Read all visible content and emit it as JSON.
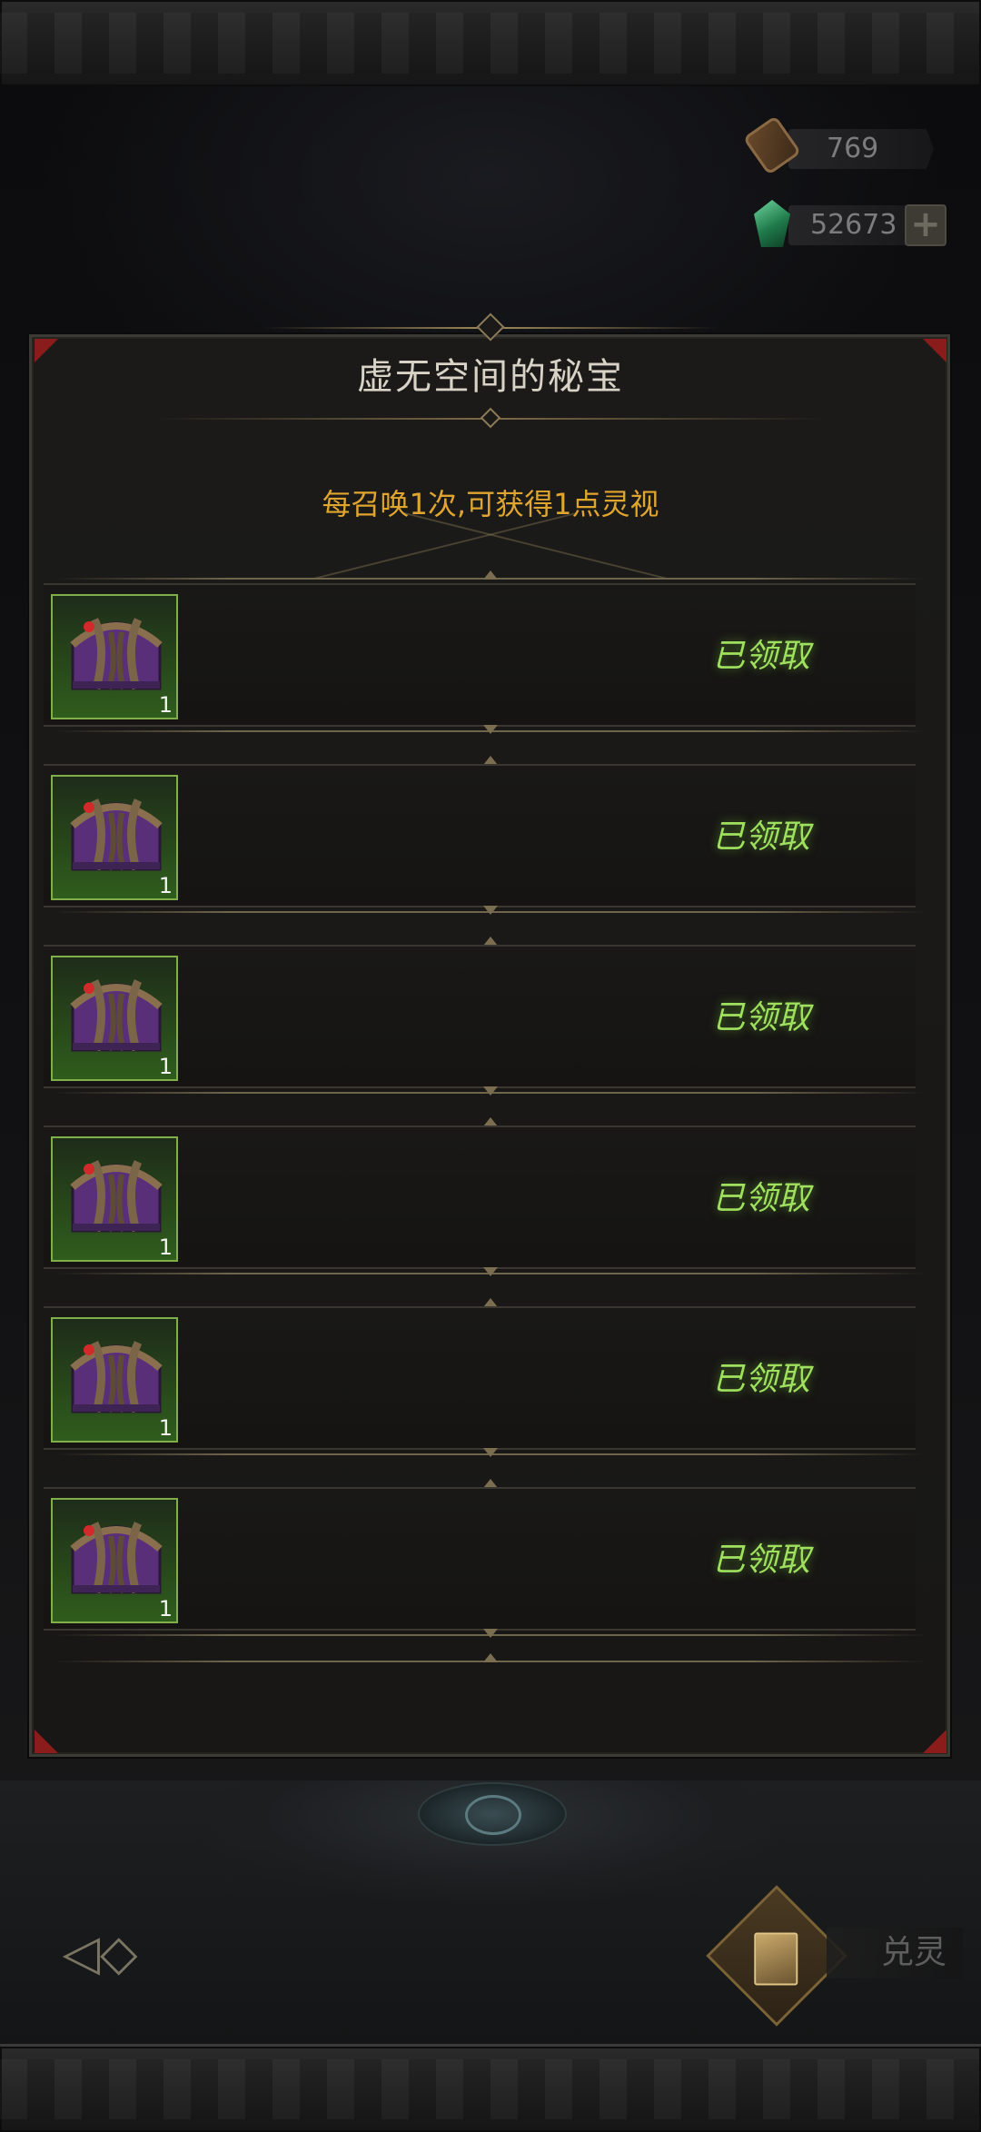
{
  "currency": {
    "scrolls": "769",
    "gems": "52673",
    "plus_label": "+"
  },
  "panel": {
    "title": "虚无空间的秘宝",
    "subtitle": "每召唤1次,可获得1点灵视"
  },
  "rewards": [
    {
      "quantity": "1",
      "status": "已领取"
    },
    {
      "quantity": "1",
      "status": "已领取"
    },
    {
      "quantity": "1",
      "status": "已领取"
    },
    {
      "quantity": "1",
      "status": "已领取"
    },
    {
      "quantity": "1",
      "status": "已领取"
    },
    {
      "quantity": "1",
      "status": "已领取"
    }
  ],
  "bottom": {
    "back_label": "◁◇",
    "exchange_label": "兑灵"
  },
  "colors": {
    "status_green": "#9fe05e",
    "subtitle_gold": "#e0a52e",
    "corner_red": "#8a1d1b"
  },
  "icons": {
    "scroll": "scroll-icon",
    "gem": "green-gem-icon",
    "chest": "purple-treasure-chest-icon",
    "card": "card-icon"
  }
}
